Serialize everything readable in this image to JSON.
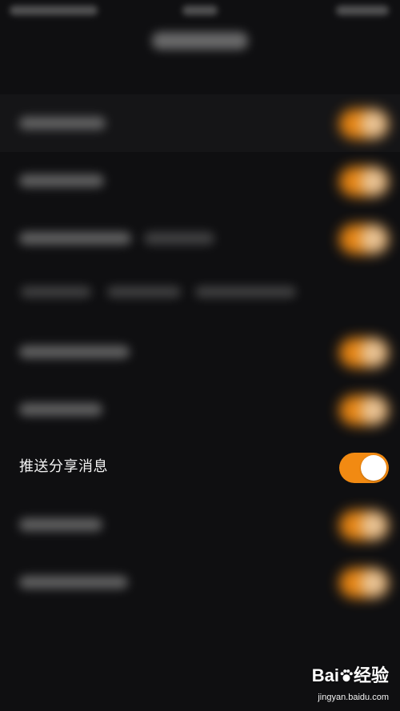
{
  "settings": {
    "focused_row": {
      "label": "推送分享消息",
      "toggle_on": true
    }
  },
  "colors": {
    "background": "#0f0f11",
    "accent": "#f28a12",
    "knob": "#ffffff",
    "label_text": "#f2f2f2"
  },
  "watermark": {
    "brand": "Bai",
    "brand_suffix": "经验",
    "url": "jingyan.baidu.com"
  }
}
